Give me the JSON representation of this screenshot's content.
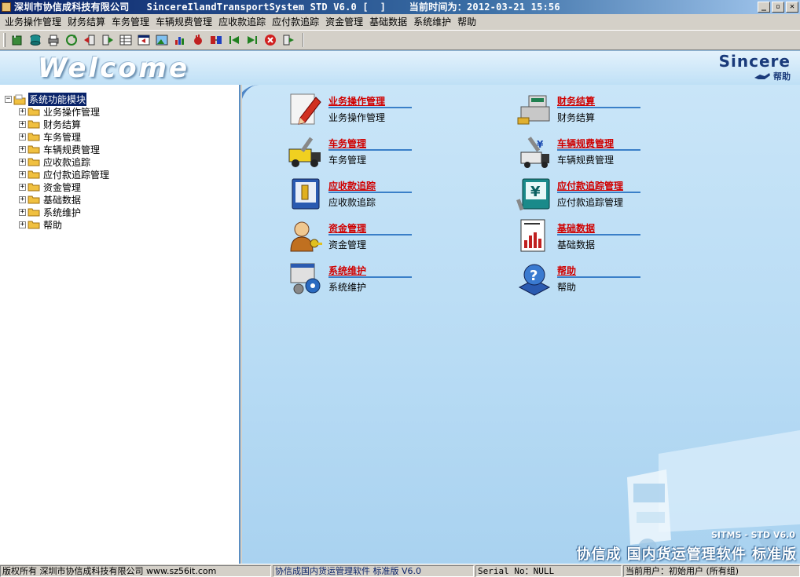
{
  "window": {
    "title": "深圳市协信成科技有限公司   SincereIlandTransportSystem STD V6.0 [  ]    当前时间为：2012-03-21 15:56",
    "controls": [
      "_",
      "▫",
      "✕"
    ]
  },
  "menu": [
    "业务操作管理",
    "财务结算",
    "车务管理",
    "车辆规费管理",
    "应收款追踪",
    "应付款追踪",
    "资金管理",
    "基础数据",
    "系统维护",
    "帮助"
  ],
  "toolbar_icons": [
    "new-record-icon",
    "database-icon",
    "print-icon",
    "refresh-icon",
    "import-icon",
    "export-icon",
    "grid-icon",
    "window-icon",
    "picture-icon",
    "chart-icon",
    "stop-hand-icon",
    "transfer-icon",
    "first-record-icon",
    "last-record-icon",
    "delete-icon",
    "exit-icon"
  ],
  "banner": {
    "welcome": "Welcome",
    "brand": "Sincere",
    "help": "帮助"
  },
  "tree": {
    "root": "系统功能模块",
    "children": [
      "业务操作管理",
      "财务结算",
      "车务管理",
      "车辆规费管理",
      "应收款追踪",
      "应付款追踪管理",
      "资金管理",
      "基础数据",
      "系统维护",
      "帮助"
    ]
  },
  "modules": [
    {
      "title": "业务操作管理",
      "sub": "业务操作管理",
      "icon": "edit-document-icon"
    },
    {
      "title": "财务结算",
      "sub": "财务结算",
      "icon": "cash-register-icon"
    },
    {
      "title": "车务管理",
      "sub": "车务管理",
      "icon": "truck-wrench-icon"
    },
    {
      "title": "车辆规费管理",
      "sub": "车辆规费管理",
      "icon": "truck-fee-icon"
    },
    {
      "title": "应收款追踪",
      "sub": "应收款追踪",
      "icon": "receivable-icon"
    },
    {
      "title": "应付款追踪管理",
      "sub": "应付款追踪管理",
      "icon": "yen-payable-icon"
    },
    {
      "title": "资金管理",
      "sub": "资金管理",
      "icon": "user-key-icon"
    },
    {
      "title": "基础数据",
      "sub": "基础数据",
      "icon": "data-chart-icon"
    },
    {
      "title": "系统维护",
      "sub": "系统维护",
      "icon": "settings-gear-icon"
    },
    {
      "title": "帮助",
      "sub": "帮助",
      "icon": "help-question-icon"
    }
  ],
  "promo": {
    "version": "SITMS - STD V6.0",
    "product": "协信成 国内货运管理软件 标准版"
  },
  "status": {
    "copyright": "版权所有 深圳市协信成科技有限公司 www.sz56it.com",
    "product": "协信成国内货运管理软件 标准版 V6.0",
    "serial": "Serial No：NULL",
    "user": "当前用户：初始用户 (所有组)"
  },
  "colors": {
    "title_start": "#0a246a",
    "module_title": "#d00000",
    "accent_blue": "#3a7fc8"
  }
}
